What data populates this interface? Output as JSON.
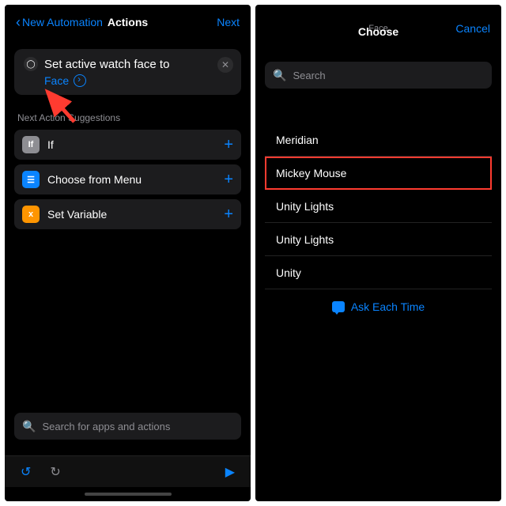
{
  "left": {
    "back": "New Automation",
    "title": "Actions",
    "next": "Next",
    "card": {
      "title": "Set active watch face to",
      "link": "Face"
    },
    "suggest_label": "Next Action Suggestions",
    "suggestions": [
      {
        "name": "If"
      },
      {
        "name": "Choose from Menu"
      },
      {
        "name": "Set Variable"
      }
    ],
    "search_placeholder": "Search for apps and actions"
  },
  "right": {
    "small_title": "Face",
    "title": "Choose",
    "cancel": "Cancel",
    "search_placeholder": "Search",
    "options": [
      {
        "name": "Meridian"
      },
      {
        "name": "Mickey Mouse",
        "highlight": true
      },
      {
        "name": "Unity Lights"
      },
      {
        "name": "Unity Lights"
      },
      {
        "name": "Unity"
      }
    ],
    "ask": "Ask Each Time"
  }
}
